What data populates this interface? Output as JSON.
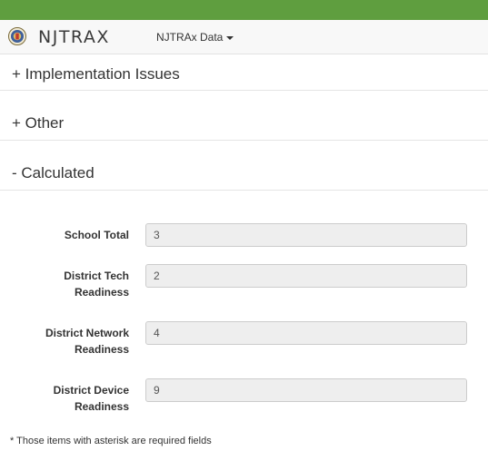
{
  "colors": {
    "top_bar": "#5f9e3f",
    "navbar_bg": "#f8f8f8",
    "readonly_input_bg": "#eeeeee"
  },
  "navbar": {
    "seal_icon": "nj-state-seal-icon",
    "brand": "NJTRAX",
    "dropdown_label": "NJTRAx Data",
    "dropdown_icon": "caret-down-icon"
  },
  "sections": {
    "implementation": "+ Implementation Issues",
    "other": "+ Other",
    "calculated": "- Calculated"
  },
  "fields": {
    "school_total": {
      "label": "School Total",
      "value": "3"
    },
    "district_tech_readiness": {
      "label_line1": "District Tech",
      "label_line2": "Readiness",
      "value": "2"
    },
    "district_network_readiness": {
      "label_line1": "District Network",
      "label_line2": "Readiness",
      "value": "4"
    },
    "district_device_readiness": {
      "label_line1": "District Device",
      "label_line2": "Readiness",
      "value": "9"
    }
  },
  "footnote": "* Those items with asterisk are required fields"
}
